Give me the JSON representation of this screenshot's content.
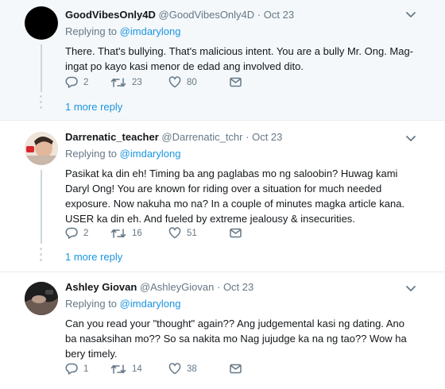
{
  "tweets": [
    {
      "name": "GoodVibesOnly4D",
      "handle": "@GoodVibesOnly4D",
      "dot": "·",
      "date": "Oct 23",
      "replying_label": "Replying to",
      "replying_to": "@imdarylong",
      "text": "There. That's bullying. That's malicious intent. You are a bully Mr. Ong. Mag-ingat po kayo kasi menor de edad ang involved dito.",
      "replies": "2",
      "retweets": "23",
      "likes": "80",
      "more_replies": "1 more reply"
    },
    {
      "name": "Darrenatic_teacher",
      "handle": "@Darrenatic_tchr",
      "dot": "·",
      "date": "Oct 23",
      "replying_label": "Replying to",
      "replying_to": "@imdarylong",
      "text": "Pasikat ka din eh! Timing ba ang paglabas mo ng saloobin? Huwag kami Daryl Ong! You are known for riding over a situation for much needed exposure. Now nakuha mo na? In a couple of minutes magka article kana. USER ka din eh. And fueled by extreme jealousy & insecurities.",
      "replies": "2",
      "retweets": "16",
      "likes": "51",
      "more_replies": "1 more reply"
    },
    {
      "name": "Ashley Giovan",
      "handle": "@AshleyGiovan",
      "dot": "·",
      "date": "Oct 23",
      "replying_label": "Replying to",
      "replying_to": "@imdarylong",
      "text": "Can you read your \"thought\" again?? Ang judgemental kasi ng dating. Ano ba nasaksihan mo?? So sa nakita mo Nag jujudge ka na ng tao?? Wow ha bery timely.",
      "replies": "1",
      "retweets": "14",
      "likes": "38"
    }
  ],
  "icons": [
    "reply-icon",
    "retweet-icon",
    "like-icon",
    "direct-message-icon",
    "chevron-down-icon"
  ],
  "colors": {
    "link": "#1b95e0",
    "muted": "#657786",
    "highlight_bg": "#f5f8fa",
    "thread": "#ccd6dd"
  }
}
